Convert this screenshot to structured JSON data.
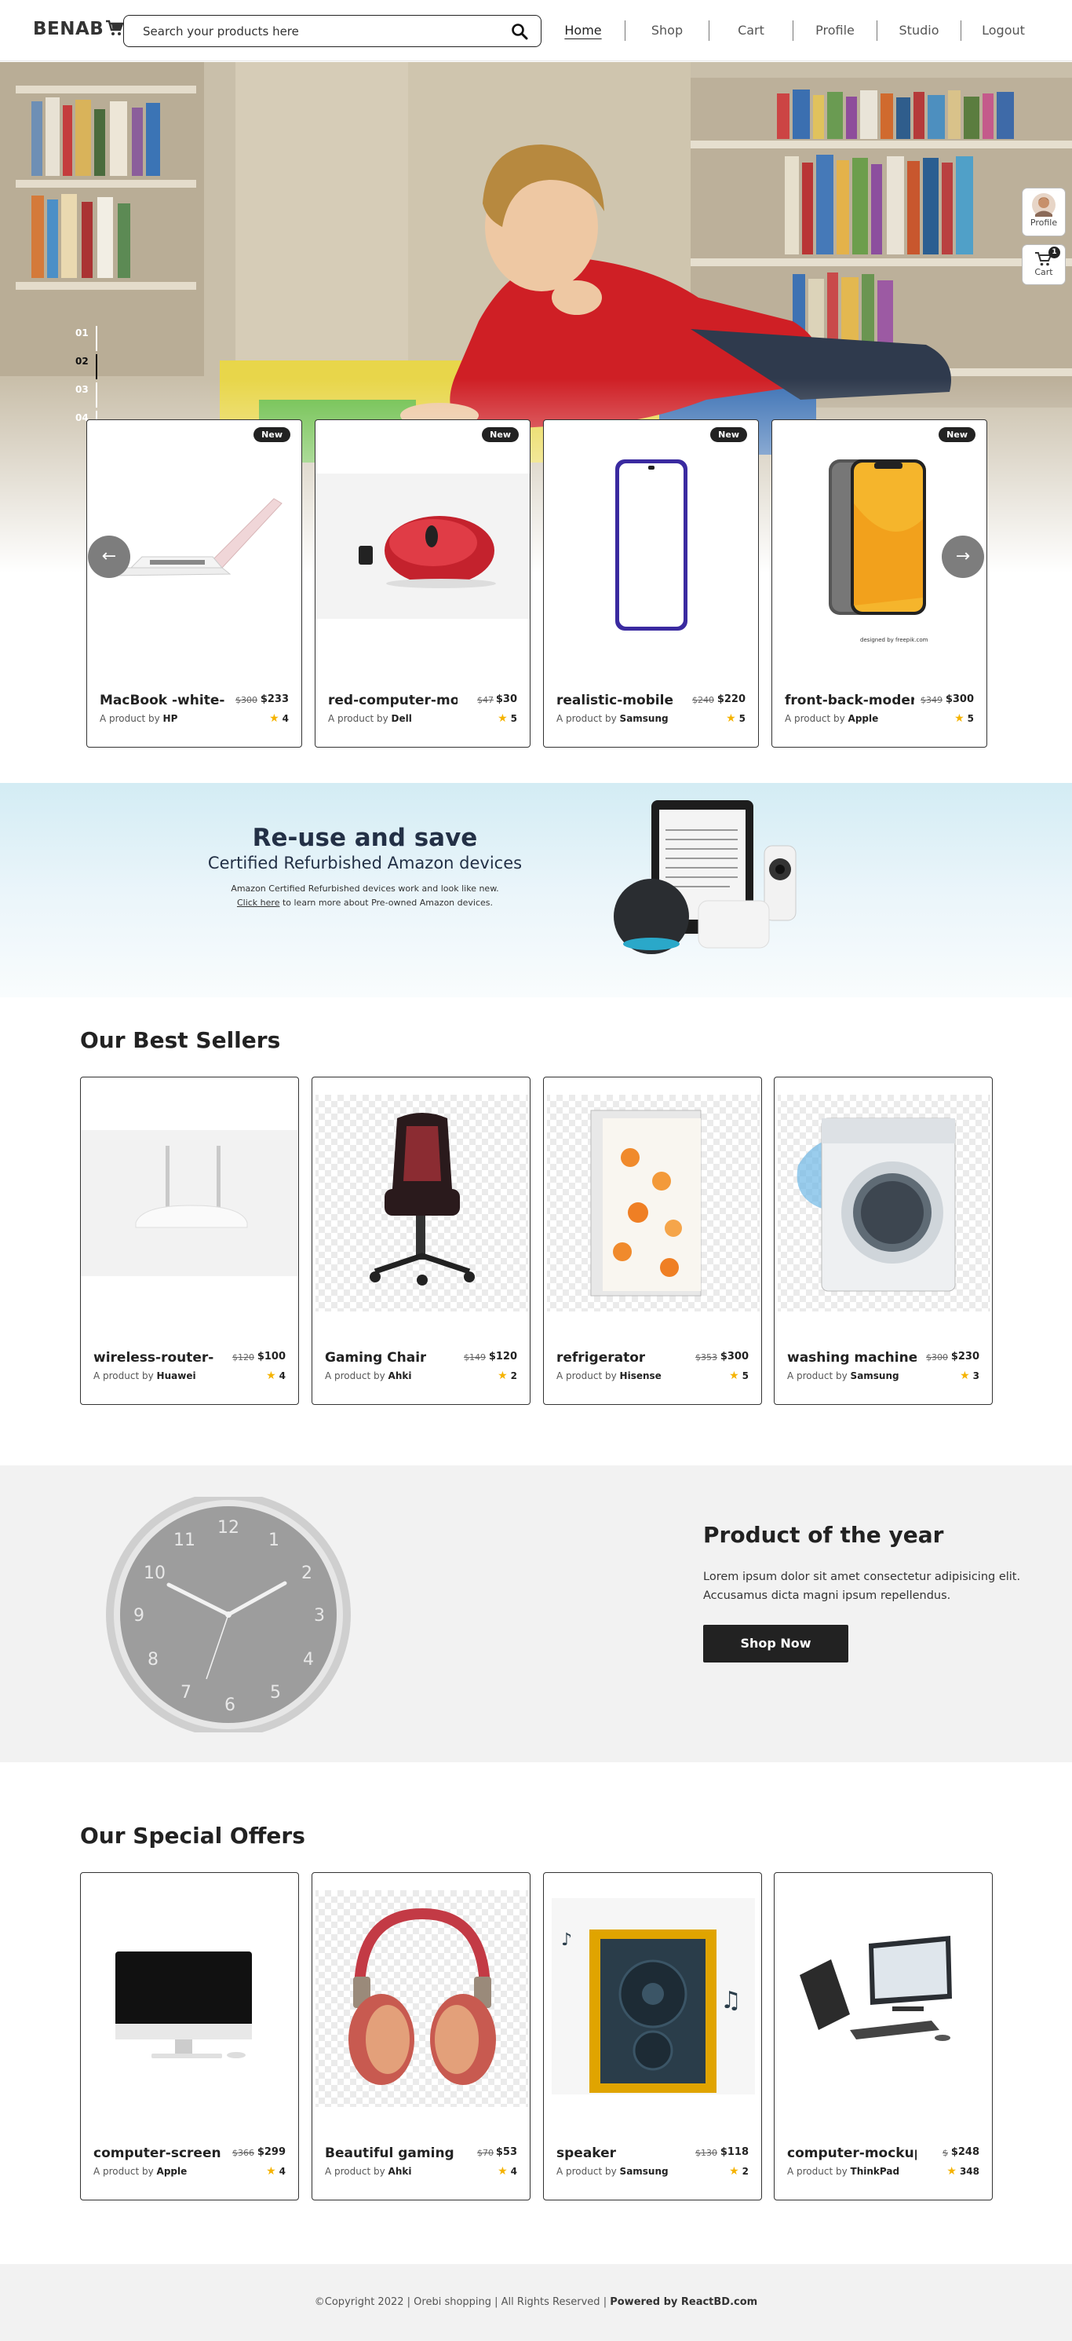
{
  "header": {
    "logo": "BENAB",
    "search_placeholder": "Search your products here",
    "nav": [
      "Home",
      "Shop",
      "Cart",
      "Profile",
      "Studio",
      "Logout"
    ],
    "active_nav": "Home"
  },
  "hero": {
    "slides": [
      "01",
      "02",
      "03",
      "04"
    ],
    "active_slide": "02"
  },
  "side_buttons": {
    "profile": "Profile",
    "cart": "Cart",
    "cart_count": "1"
  },
  "new_arrivals": [
    {
      "badge": "New",
      "name": "MacBook -white-",
      "old_price": "$300",
      "price": "$233",
      "prefix": "A product by",
      "brand": "HP",
      "rating": "4"
    },
    {
      "badge": "New",
      "name": "red-computer-mou",
      "old_price": "$47",
      "price": "$30",
      "prefix": "A product by",
      "brand": "Dell",
      "rating": "5"
    },
    {
      "badge": "New",
      "name": "realistic-mobile",
      "old_price": "$240",
      "price": "$220",
      "prefix": "A product by",
      "brand": "Samsung",
      "rating": "5"
    },
    {
      "badge": "New",
      "name": "front-back-moder",
      "old_price": "$349",
      "price": "$300",
      "prefix": "A product by",
      "brand": "Apple",
      "rating": "5"
    }
  ],
  "banner": {
    "title": "Re-use and save",
    "subtitle": "Certified Refurbished Amazon devices",
    "line1": "Amazon Certified Refurbished devices work and look like new.",
    "link": "Click here",
    "line2_rest": " to learn more about Pre-owned Amazon devices."
  },
  "best_sellers": {
    "title": "Our Best Sellers",
    "items": [
      {
        "name": "wireless-router-",
        "old_price": "$120",
        "price": "$100",
        "prefix": "A product by",
        "brand": "Huawei",
        "rating": "4"
      },
      {
        "name": "Gaming Chair",
        "old_price": "$149",
        "price": "$120",
        "prefix": "A product by",
        "brand": "Ahki",
        "rating": "2"
      },
      {
        "name": "refrigerator",
        "old_price": "$353",
        "price": "$300",
        "prefix": "A product by",
        "brand": "Hisense",
        "rating": "5"
      },
      {
        "name": "washing machine",
        "old_price": "$300",
        "price": "$230",
        "prefix": "A product by",
        "brand": "Samsung",
        "rating": "3"
      }
    ]
  },
  "product_of_year": {
    "title": "Product of the year",
    "text": "Lorem ipsum dolor sit amet consectetur adipisicing elit. Accusamus dicta magni ipsum repellendus.",
    "button": "Shop Now",
    "clock_numbers": [
      "12",
      "1",
      "2",
      "3",
      "4",
      "5",
      "6",
      "7",
      "8",
      "9",
      "10",
      "11"
    ]
  },
  "special_offers": {
    "title": "Our Special Offers",
    "items": [
      {
        "name": "computer-screen",
        "old_price": "$366",
        "price": "$299",
        "prefix": "A product by",
        "brand": "Apple",
        "rating": "4"
      },
      {
        "name": "Beautiful gaming",
        "old_price": "$70",
        "price": "$53",
        "prefix": "A product by",
        "brand": "Ahki",
        "rating": "4"
      },
      {
        "name": "speaker",
        "old_price": "$130",
        "price": "$118",
        "prefix": "A product by",
        "brand": "Samsung",
        "rating": "2"
      },
      {
        "name": "computer-mockup",
        "old_price": "$",
        "price": "$248",
        "prefix": "A product by",
        "brand": "ThinkPad",
        "rating": "348"
      }
    ]
  },
  "footer": {
    "copyright": "©Copyright 2022 | Orebi shopping | All Rights Reserved | ",
    "powered": "Powered by ReactBD.com"
  },
  "colors": {
    "accent": "#222222",
    "star": "#f5b301",
    "banner_bg": "#d3ecf4",
    "footer_bg": "#f2f2f2"
  }
}
